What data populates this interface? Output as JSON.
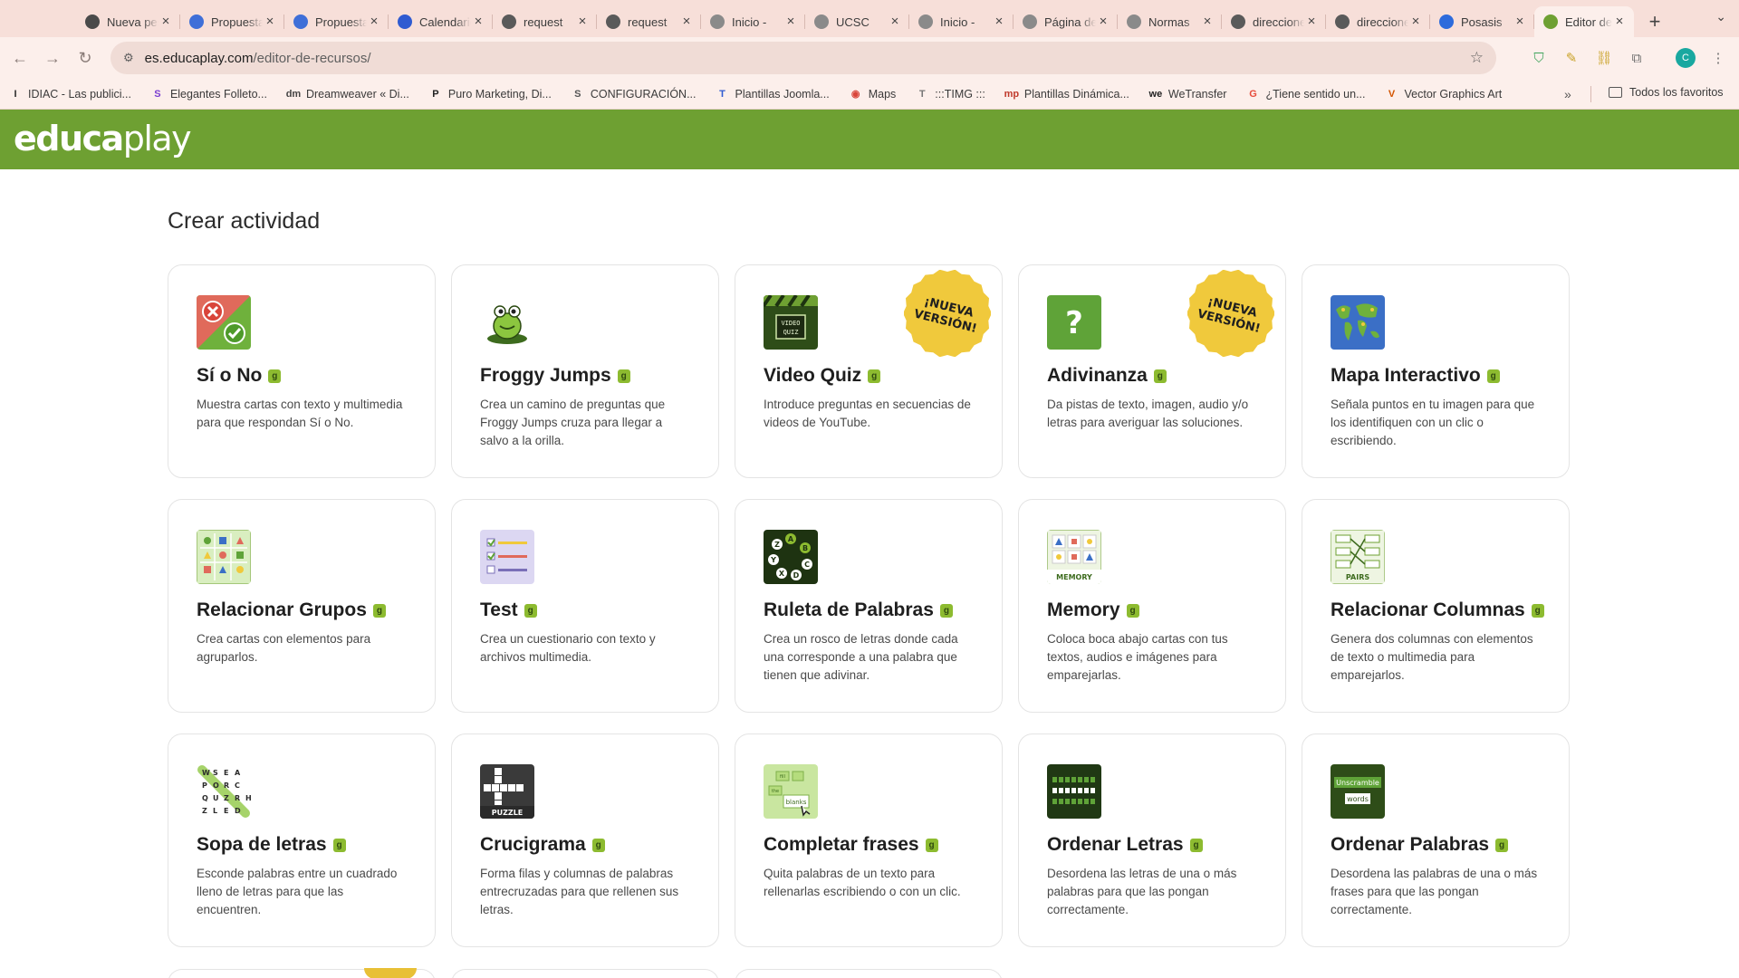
{
  "browser": {
    "tabs": [
      {
        "title": "Nueva pestaña",
        "icon": "chrome-icon",
        "color": "#4a4a4a"
      },
      {
        "title": "Propuesta",
        "icon": "canva-icon",
        "color": "#3f6fd8"
      },
      {
        "title": "Propuesta",
        "icon": "canva-icon",
        "color": "#3f6fd8"
      },
      {
        "title": "Calendario",
        "icon": "calendar-icon",
        "color": "#2f5bd1"
      },
      {
        "title": "request",
        "icon": "globe-icon",
        "color": "#5a5a5a"
      },
      {
        "title": "request",
        "icon": "globe-icon",
        "color": "#5a5a5a"
      },
      {
        "title": "Inicio - ",
        "icon": "shield-logo-icon",
        "color": "#8a8a8a"
      },
      {
        "title": "UCSC",
        "icon": "shield-logo-icon",
        "color": "#8a8a8a"
      },
      {
        "title": "Inicio - ",
        "icon": "shield-logo-icon",
        "color": "#8a8a8a"
      },
      {
        "title": "Página de",
        "icon": "shield-logo-icon",
        "color": "#8a8a8a"
      },
      {
        "title": "Normas",
        "icon": "shield-logo-icon",
        "color": "#8a8a8a"
      },
      {
        "title": "direcciones",
        "icon": "globe-icon",
        "color": "#5a5a5a"
      },
      {
        "title": "direcciones",
        "icon": "globe-icon",
        "color": "#5a5a5a"
      },
      {
        "title": "Posasis",
        "icon": "zm-icon",
        "color": "#2d6bdc"
      },
      {
        "title": "Editor de",
        "icon": "educaplay-favicon",
        "color": "#6ea032",
        "active": true
      }
    ],
    "url_host": "es.educaplay.com",
    "url_path": "/editor-de-recursos/",
    "bookmarks": [
      {
        "label": "IDIAC - Las publici...",
        "icon": "I",
        "color": "#2b2b2b"
      },
      {
        "label": "Elegantes Folleto...",
        "icon": "S",
        "color": "#7a3fd1"
      },
      {
        "label": "Dreamweaver « Di...",
        "icon": "dm",
        "color": "#444"
      },
      {
        "label": "Puro Marketing, Di...",
        "icon": "P",
        "color": "#222"
      },
      {
        "label": "CONFIGURACIÓN...",
        "icon": "S",
        "color": "#555"
      },
      {
        "label": "Plantillas Joomla...",
        "icon": "T",
        "color": "#2f5bd1"
      },
      {
        "label": "Maps",
        "icon": "◉",
        "color": "#d9463b"
      },
      {
        "label": ":::TIMG :::",
        "icon": "T",
        "color": "#777"
      },
      {
        "label": "Plantillas Dinámica...",
        "icon": "mp",
        "color": "#c0392b"
      },
      {
        "label": "WeTransfer",
        "icon": "we",
        "color": "#222"
      },
      {
        "label": "¿Tiene sentido un...",
        "icon": "G",
        "color": "#e74c3c"
      },
      {
        "label": "Vector Graphics Art",
        "icon": "V",
        "color": "#d35400"
      }
    ],
    "all_bookmarks": "Todos los favoritos",
    "profile_initial": "C"
  },
  "site": {
    "logo_bold": "educa",
    "logo_light": "play",
    "header_color": "#6ea032",
    "page_title": "Crear actividad"
  },
  "activities": [
    {
      "title": "Sí o No",
      "desc": "Muestra cartas con texto y multimedia para que respondan Sí o No.",
      "icon": "yes-no-icon",
      "new": false
    },
    {
      "title": "Froggy Jumps",
      "desc": "Crea un camino de preguntas que Froggy Jumps cruza para llegar a salvo a la orilla.",
      "icon": "frog-icon",
      "new": false
    },
    {
      "title": "Video Quiz",
      "desc": "Introduce preguntas en secuencias de videos de YouTube.",
      "icon": "video-quiz-icon",
      "new": true
    },
    {
      "title": "Adivinanza",
      "desc": "Da pistas de texto, imagen, audio y/o letras para averiguar las soluciones.",
      "icon": "riddle-question-icon",
      "new": true
    },
    {
      "title": "Mapa Interactivo",
      "desc": "Señala puntos en tu imagen para que los identifiquen con un clic o escribiendo.",
      "icon": "world-map-icon",
      "new": false
    },
    {
      "title": "Relacionar Grupos",
      "desc": "Crea cartas con elementos para agruparlos.",
      "icon": "group-shapes-icon",
      "new": false
    },
    {
      "title": "Test",
      "desc": "Crea un cuestionario con texto y archivos multimedia.",
      "icon": "checklist-icon",
      "new": false
    },
    {
      "title": "Ruleta de Palabras",
      "desc": "Crea un rosco de letras donde cada una corresponde a una palabra que tienen que adivinar.",
      "icon": "letter-wheel-icon",
      "new": false
    },
    {
      "title": "Memory",
      "desc": "Coloca boca abajo cartas con tus textos, audios e imágenes para emparejarlas.",
      "icon": "memory-cards-icon",
      "new": false
    },
    {
      "title": "Relacionar Columnas",
      "desc": "Genera dos columnas con elementos de texto o multimedia para emparejarlos.",
      "icon": "pairs-icon",
      "new": false
    },
    {
      "title": "Sopa de letras",
      "desc": "Esconde palabras entre un cuadrado lleno de letras para que las encuentren.",
      "icon": "word-search-icon",
      "new": false
    },
    {
      "title": "Crucigrama",
      "desc": "Forma filas y columnas de palabras entrecruzadas para que rellenen sus letras.",
      "icon": "crossword-icon",
      "new": false
    },
    {
      "title": "Completar frases",
      "desc": "Quita palabras de un texto para rellenarlas escribiendo o con un clic.",
      "icon": "fill-blanks-icon",
      "new": false
    },
    {
      "title": "Ordenar Letras",
      "desc": "Desordena las letras de una o más palabras para que las pongan correctamente.",
      "icon": "unscramble-letters-icon",
      "new": false
    },
    {
      "title": "Ordenar Palabras",
      "desc": "Desordena las palabras de una o más frases para que las pongan correctamente.",
      "icon": "unscramble-words-icon",
      "new": false
    }
  ],
  "thumb_text": {
    "video_quiz": "VIDEO QUIZ",
    "memory": "MEMORY",
    "pairs": "PAIRS",
    "puzzle": "PUZZLE",
    "fill_in": "fill",
    "fill_the": "the",
    "fill_blanks": "blanks",
    "unscramble": "Unscramble",
    "words": "words",
    "wordsearch_rows": [
      "WSEA",
      "PORC",
      "QUZRH",
      "ZLED"
    ]
  },
  "new_badge_text": [
    "¡NUEVA",
    "VERSIÓN!"
  ],
  "pro_badge_glyph": "g",
  "colors": {
    "accent_green": "#6ea032",
    "badge_yellow": "#f0c93c"
  }
}
